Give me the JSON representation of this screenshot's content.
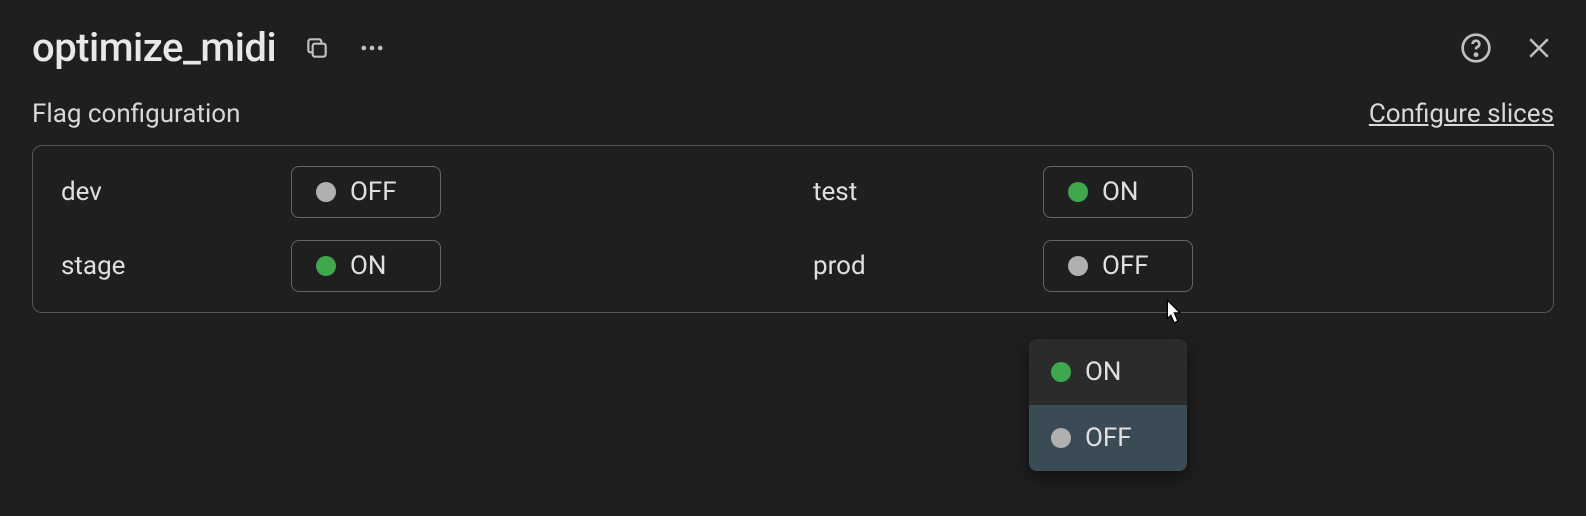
{
  "header": {
    "title": "optimize_midi"
  },
  "subheader": {
    "title": "Flag configuration",
    "link": "Configure slices"
  },
  "labels": {
    "on": "ON",
    "off": "OFF"
  },
  "environments": [
    {
      "name": "dev",
      "state": "off"
    },
    {
      "name": "test",
      "state": "on"
    },
    {
      "name": "stage",
      "state": "on"
    },
    {
      "name": "prod",
      "state": "off"
    }
  ],
  "dropdown": {
    "options": [
      {
        "label": "ON",
        "state": "on",
        "highlighted": false
      },
      {
        "label": "OFF",
        "state": "off",
        "highlighted": true
      }
    ]
  }
}
